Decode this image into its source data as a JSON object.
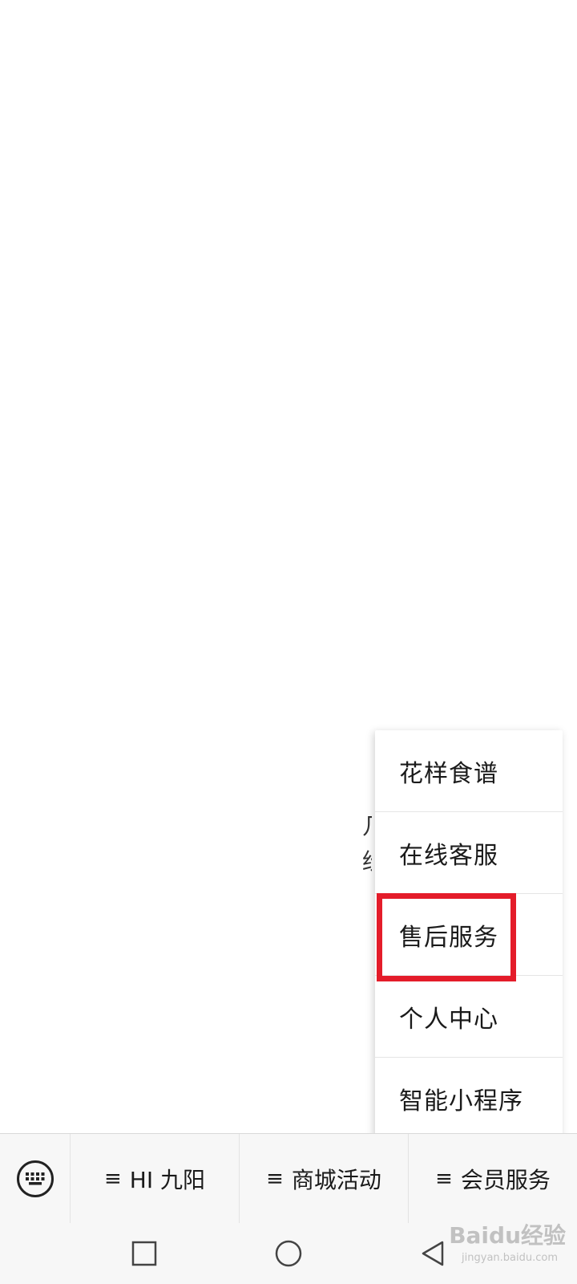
{
  "popup_menu": {
    "items": [
      {
        "label": "花样食谱"
      },
      {
        "label": "在线客服"
      },
      {
        "label": "售后服务"
      },
      {
        "label": "个人中心"
      },
      {
        "label": "智能小程序"
      }
    ],
    "highlight_color": "#e41c2a"
  },
  "menu_bar": {
    "keyboard_icon": "keyboard-icon",
    "tabs": [
      {
        "glyph": "≡",
        "label": "HI 九阳"
      },
      {
        "glyph": "≡",
        "label": "商城活动"
      },
      {
        "glyph": "≡",
        "label": "会员服务"
      }
    ]
  },
  "nav_bar": {
    "icons": [
      "square-recents-icon",
      "circle-home-icon",
      "triangle-back-icon"
    ]
  },
  "background_fragments": {
    "f1": "几",
    "f2": "纷",
    "f3": "…"
  },
  "watermark": {
    "text": "Baidu经验",
    "sub": "jingyan.baidu.com"
  }
}
